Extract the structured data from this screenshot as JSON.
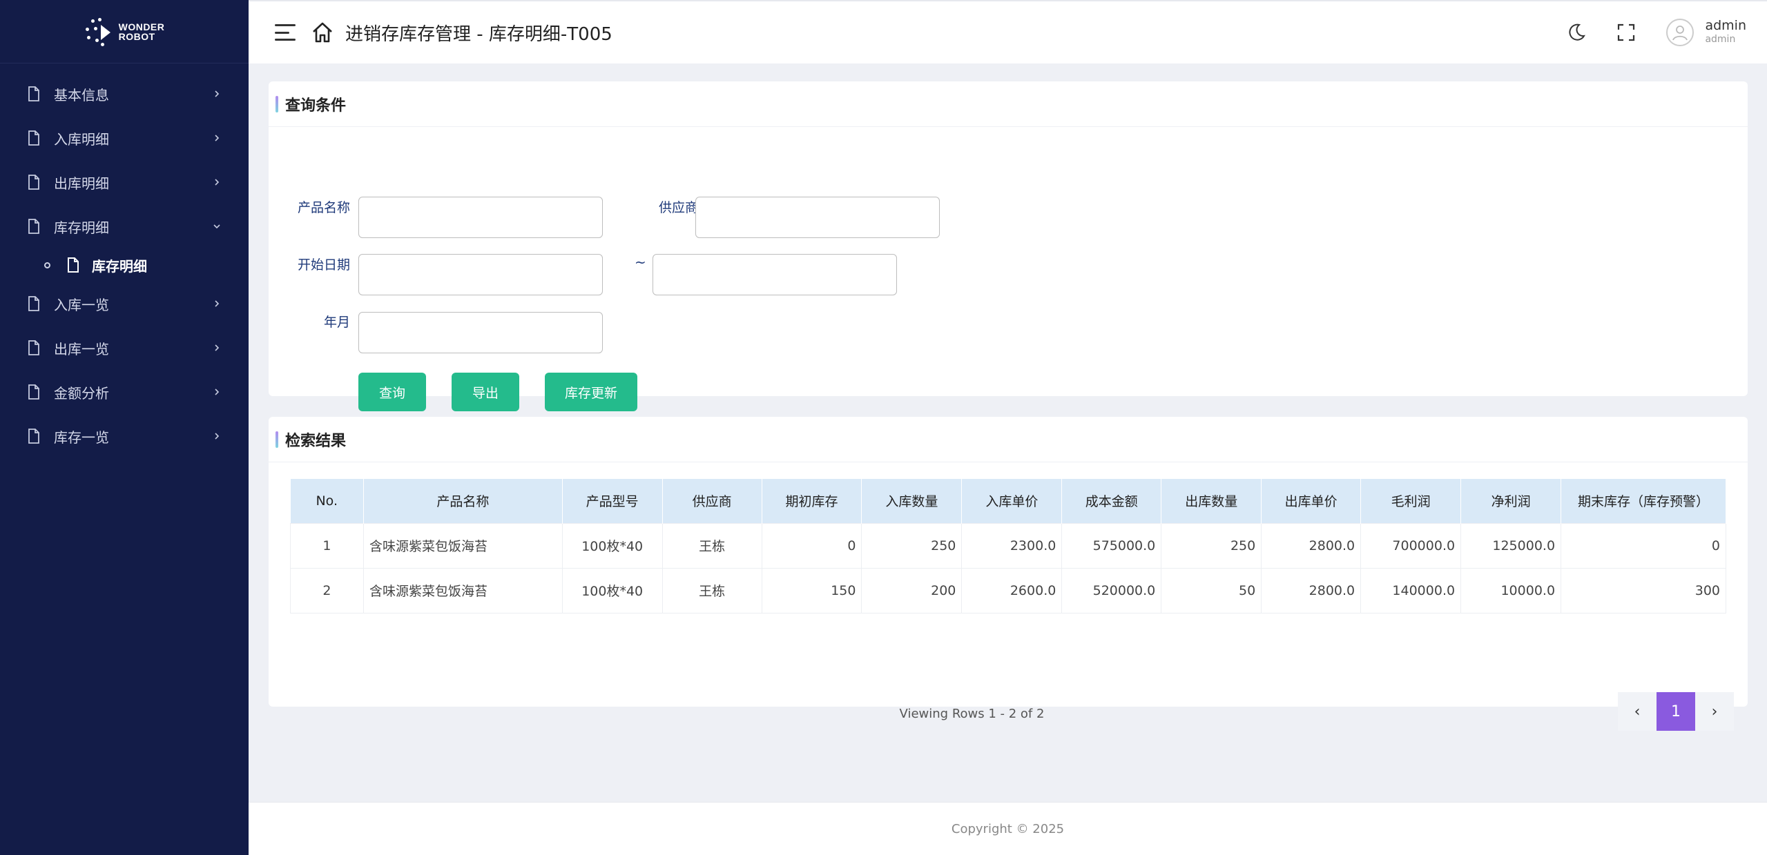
{
  "logo": {
    "line1": "WONDER",
    "line2": "ROBOT"
  },
  "sidebar": {
    "items": [
      {
        "label": "基本信息"
      },
      {
        "label": "入库明细"
      },
      {
        "label": "出库明细"
      },
      {
        "label": "库存明细",
        "expanded": true,
        "children": [
          {
            "label": "库存明细"
          }
        ]
      },
      {
        "label": "入库一览"
      },
      {
        "label": "出库一览"
      },
      {
        "label": "金额分析"
      },
      {
        "label": "库存一览"
      }
    ]
  },
  "header": {
    "title": "进销存库存管理 - 库存明细-T005",
    "user_name": "admin",
    "user_role": "admin"
  },
  "query": {
    "title": "查询条件",
    "product_name_label": "产品名称",
    "product_name_value": "",
    "supplier_label": "供应商",
    "supplier_value": "",
    "start_date_label": "开始日期",
    "start_date_value": "",
    "date_separator": "~",
    "end_date_value": "",
    "month_label": "年月",
    "month_value": "",
    "search_button": "查询",
    "export_button": "导出",
    "update_button": "库存更新"
  },
  "results": {
    "title": "检索结果",
    "columns": [
      "No.",
      "产品名称",
      "产品型号",
      "供应商",
      "期初库存",
      "入库数量",
      "入库单价",
      "成本金额",
      "出库数量",
      "出库单价",
      "毛利润",
      "净利润",
      "期末库存（库存预警）"
    ],
    "rows": [
      [
        "1",
        "含味源紫菜包饭海苔",
        "100枚*40",
        "王栋",
        "0",
        "250",
        "2300.0",
        "575000.0",
        "250",
        "2800.0",
        "700000.0",
        "125000.0",
        "0"
      ],
      [
        "2",
        "含味源紫菜包饭海苔",
        "100枚*40",
        "王栋",
        "150",
        "200",
        "2600.0",
        "520000.0",
        "50",
        "2800.0",
        "140000.0",
        "10000.0",
        "300"
      ]
    ],
    "viewing": "Viewing Rows 1 - 2 of 2",
    "pager": {
      "prev": "‹",
      "current": "1",
      "next": "›"
    }
  },
  "footer": {
    "copyright": "Copyright © 2025"
  },
  "colors": {
    "sidebar_bg": "#131c48",
    "button": "#24bb8c",
    "pager_active": "#8a5adf",
    "table_header": "#d9e9f7"
  }
}
